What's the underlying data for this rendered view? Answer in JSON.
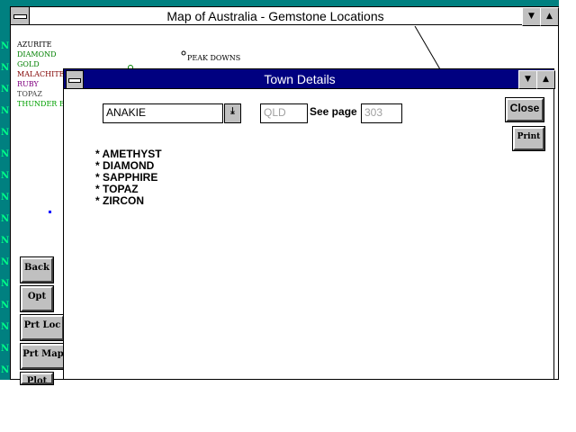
{
  "map_window": {
    "title": "Map of Australia - Gemstone Locations",
    "minimize": "▼",
    "maximize": "▲",
    "legend": [
      {
        "label": "AZURITE",
        "color": "#000000"
      },
      {
        "label": "DIAMOND",
        "color": "#008000"
      },
      {
        "label": "GOLD",
        "color": "#008000"
      },
      {
        "label": "MALACHITE",
        "color": "#800000"
      },
      {
        "label": "RUBY",
        "color": "#800080"
      },
      {
        "label": "TOPAZ",
        "color": "#404040"
      },
      {
        "label": "THUNDER EG",
        "color": "#00a000"
      }
    ],
    "town_label": "PEAK DOWNS",
    "buttons": {
      "back": "Back",
      "opt": "Opt",
      "prt_loc": "Prt Loc",
      "prt_map": "Prt Map",
      "plot": "Plot"
    }
  },
  "dialog": {
    "title": "Town Details",
    "minimize": "▼",
    "maximize": "▲",
    "town": "ANAKIE",
    "state": "QLD",
    "see_page_label": "See page",
    "page": "303",
    "close": "Close",
    "print": "Print",
    "gemstones": [
      "* AMETHYST",
      "* DIAMOND",
      "* SAPPHIRE",
      "* TOPAZ",
      "* ZIRCON"
    ]
  }
}
